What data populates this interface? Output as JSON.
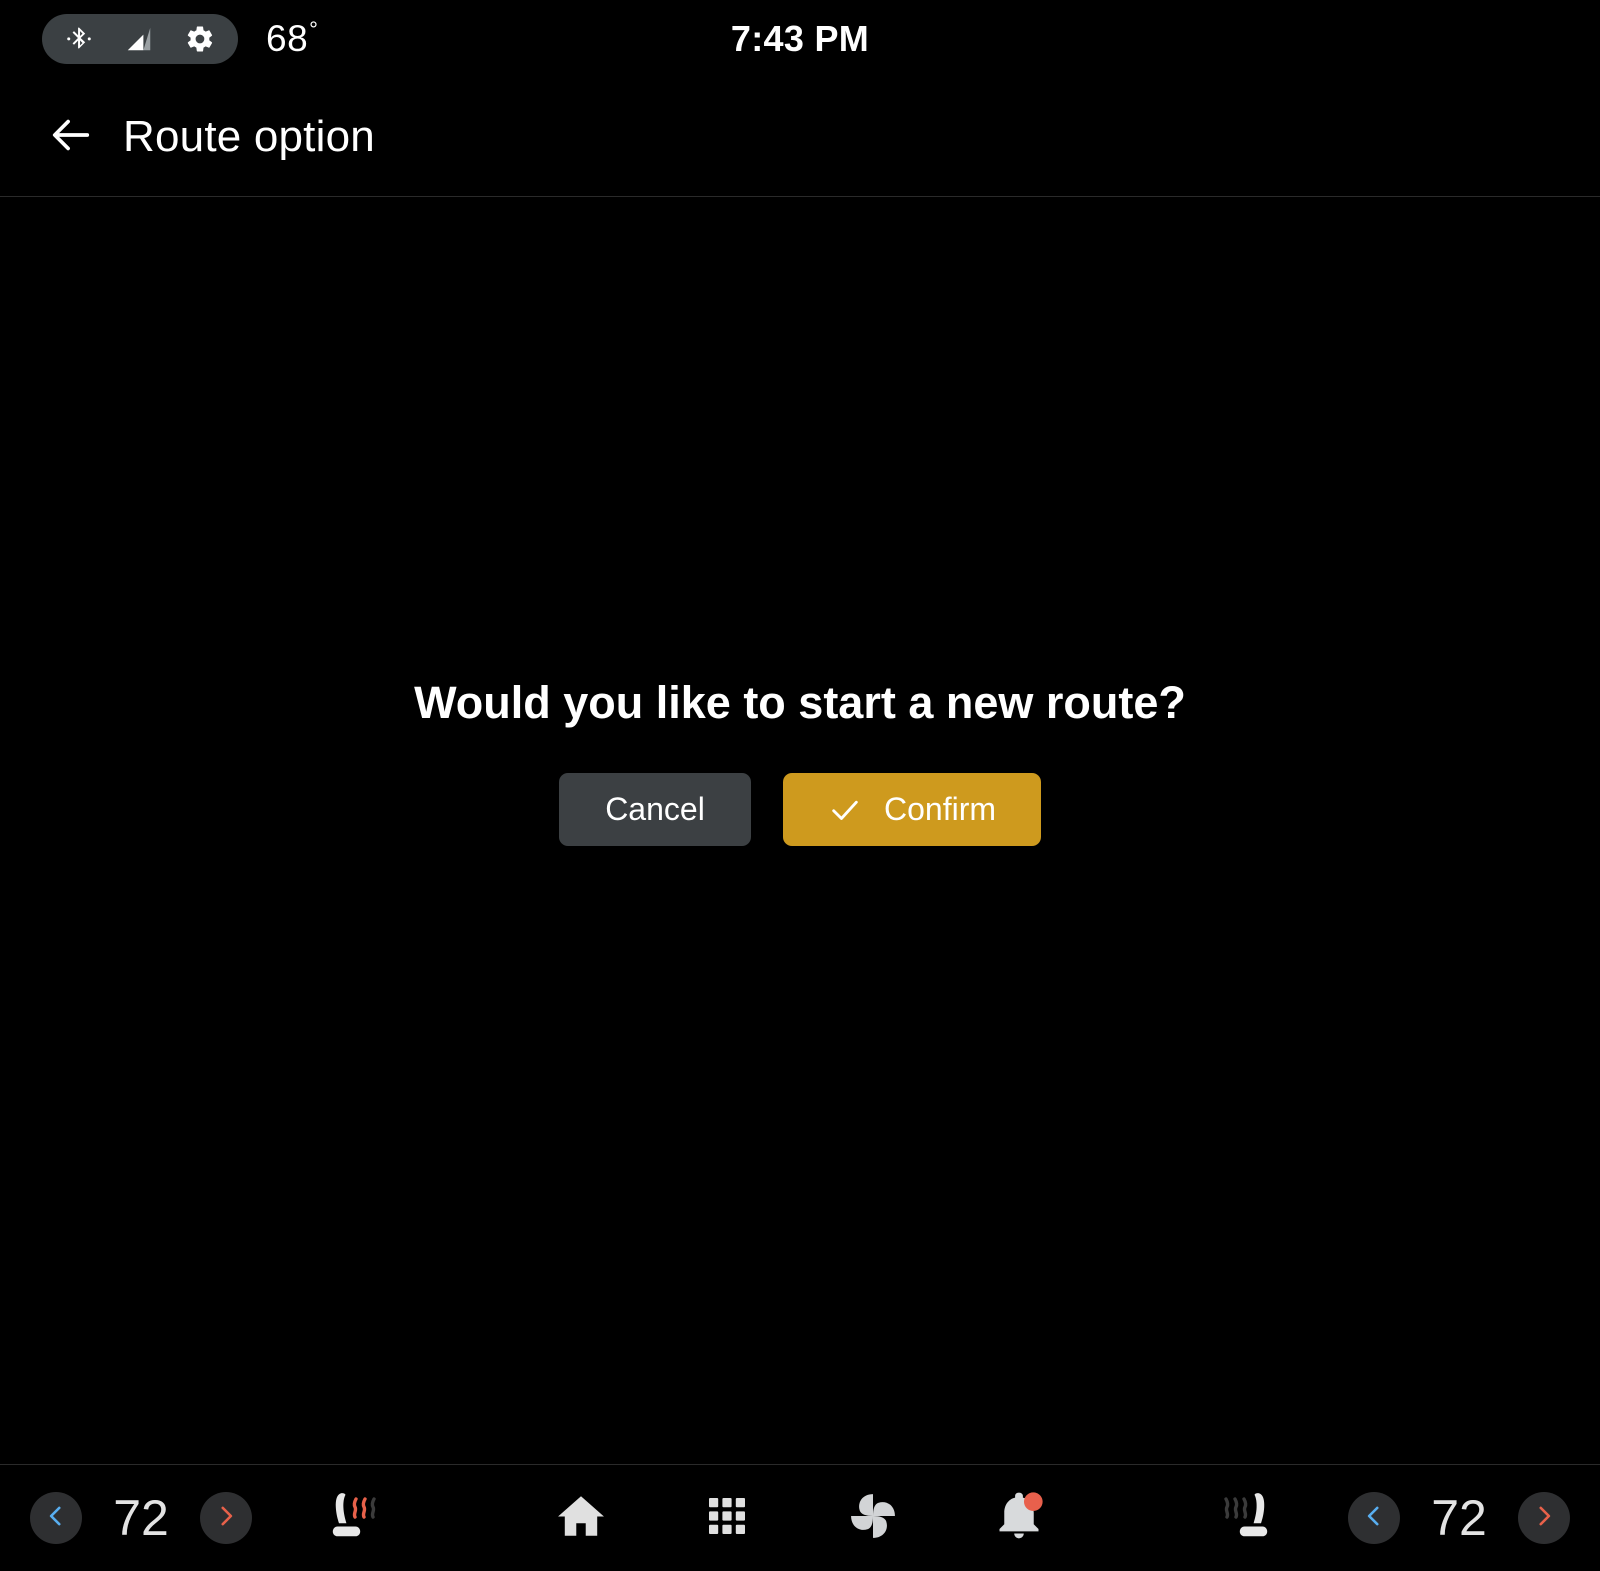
{
  "status_bar": {
    "icons": [
      "bluetooth-icon",
      "cellular-signal-icon",
      "gear-icon"
    ],
    "outside_temp": "68",
    "degree_symbol": "°",
    "clock": "7:43 PM"
  },
  "header": {
    "back_icon": "back-arrow-icon",
    "title": "Route option"
  },
  "dialog": {
    "title": "Would you like to start a new route?",
    "cancel_label": "Cancel",
    "confirm_label": "Confirm",
    "confirm_icon": "check-icon",
    "cancel_color": "#3c4043",
    "confirm_color": "#ce9a1e"
  },
  "bottom_bar": {
    "left_climate": {
      "decrease_icon": "chevron-left-icon",
      "temperature": "72",
      "increase_icon": "chevron-right-icon",
      "seat_icon": "heated-seat-icon",
      "seat_state": "on"
    },
    "right_climate": {
      "seat_icon": "heated-seat-icon",
      "seat_state": "off",
      "decrease_icon": "chevron-left-icon",
      "temperature": "72",
      "increase_icon": "chevron-right-icon"
    },
    "nav_items": [
      {
        "name": "home-icon",
        "label": "Home"
      },
      {
        "name": "apps-grid-icon",
        "label": "Apps"
      },
      {
        "name": "fan-icon",
        "label": "Climate"
      },
      {
        "name": "bell-icon",
        "label": "Notifications",
        "badge": true
      }
    ],
    "colors": {
      "cool_accent": "#58aef0",
      "heat_accent": "#e8614a",
      "button_bg": "#2e2f31",
      "notification_dot": "#e8604c"
    }
  }
}
